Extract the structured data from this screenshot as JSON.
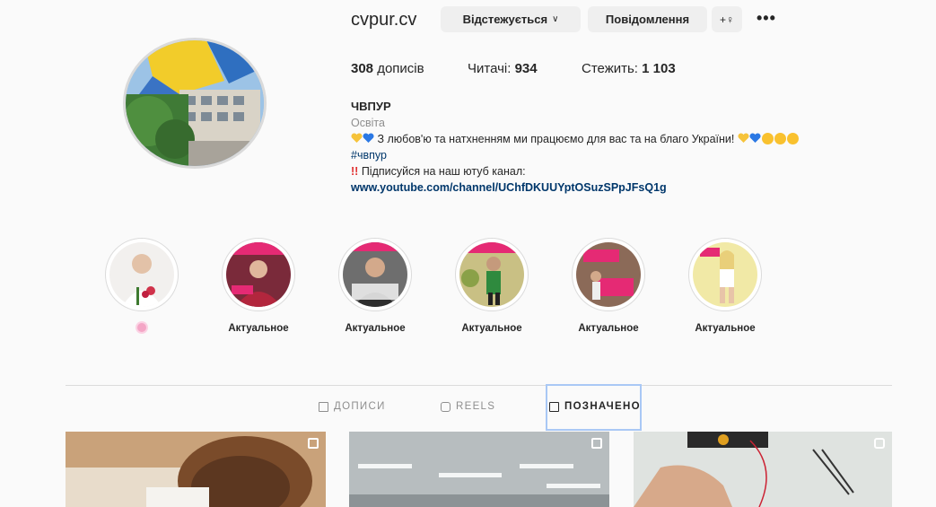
{
  "profile": {
    "username": "cvpur.cv",
    "follow_label": "Відстежується",
    "message_label": "Повідомлення",
    "add_label": "+♀",
    "more_label": "•••"
  },
  "stats": {
    "posts": "308",
    "posts_label": "дописів",
    "followers_label": "Читачі:",
    "followers": "934",
    "following_label": "Стежить:",
    "following": "1 103"
  },
  "bio": {
    "name": "ЧВПУР",
    "category": "Освіта",
    "line1": "З любов'ю та натхненням ми працюємо для вас та на благо України!",
    "hashtag": "#чвпур",
    "line3": "Підписуйся на наш ютуб канал:",
    "link": "www.youtube.com/channel/UChfDKUUYptOSuzSPpJFsQ1g"
  },
  "highlights": [
    {
      "label": ""
    },
    {
      "label": "Актуальное"
    },
    {
      "label": "Актуальное"
    },
    {
      "label": "Актуальное"
    },
    {
      "label": "Актуальное"
    },
    {
      "label": "Актуальное"
    }
  ],
  "tabs": {
    "posts": "ДОПИСИ",
    "reels": "REELS",
    "tagged": "ПОЗНАЧЕНО"
  },
  "colors": {
    "link": "#00376b",
    "button_bg": "#efefef",
    "active_tab_outline": "#a9c8f5"
  }
}
